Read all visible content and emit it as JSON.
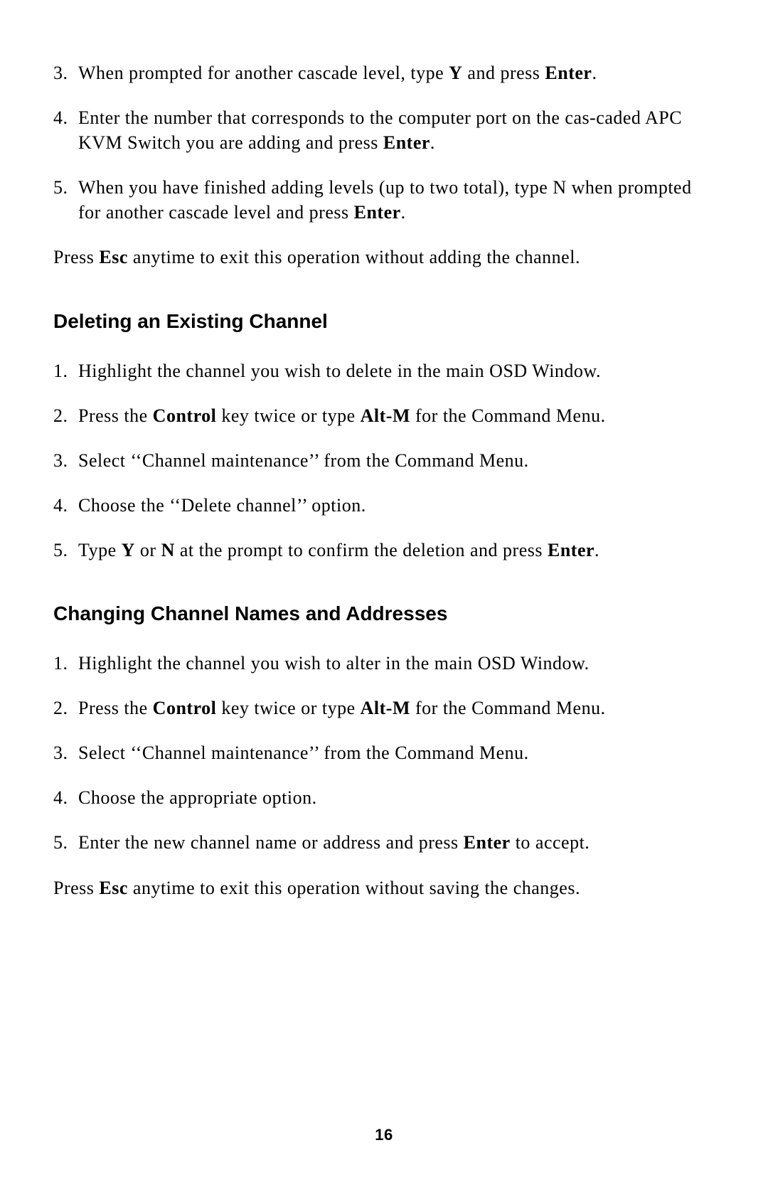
{
  "section1": {
    "items": [
      {
        "num": "3.",
        "pre": "When prompted for another cascade level, type ",
        "b1": "Y",
        "mid": " and press ",
        "b2": "Enter",
        "post": "."
      },
      {
        "num": "4.",
        "pre": "Enter the number that corresponds to the computer port on the cas-caded APC KVM Switch you are adding and press ",
        "b1": "Enter",
        "mid": "",
        "b2": "",
        "post": "."
      },
      {
        "num": "5.",
        "pre": "When you have finished adding levels (up to two total), type N when prompted for another cascade level and press ",
        "b1": "Enter",
        "mid": "",
        "b2": "",
        "post": "."
      }
    ],
    "footer": {
      "pre": "Press ",
      "b1": "Esc",
      "post": " anytime to exit this operation without adding the channel."
    }
  },
  "section2": {
    "heading": "Deleting an Existing Channel",
    "items": [
      {
        "num": "1.",
        "pre": "Highlight the channel you wish to delete in the main OSD Window.",
        "b1": "",
        "mid": "",
        "b2": "",
        "post": ""
      },
      {
        "num": "2.",
        "pre": "Press the ",
        "b1": "Control",
        "mid": " key twice or type ",
        "b2": "Alt-M",
        "post": " for the Command Menu."
      },
      {
        "num": "3.",
        "pre": "Select ‘‘Channel maintenance’’ from the Command Menu.",
        "b1": "",
        "mid": "",
        "b2": "",
        "post": ""
      },
      {
        "num": "4.",
        "pre": "Choose the ‘‘Delete channel’’ option.",
        "b1": "",
        "mid": "",
        "b2": "",
        "post": ""
      },
      {
        "num": "5.",
        "pre": "Type ",
        "b1": "Y",
        "mid": " or ",
        "b2": "N",
        "post_pre": " at the prompt to confirm the deletion and press ",
        "b3": "Enter",
        "post": "."
      }
    ]
  },
  "section3": {
    "heading": "Changing Channel Names and Addresses",
    "items": [
      {
        "num": "1.",
        "pre": "Highlight the channel you wish to alter in the main OSD Window.",
        "b1": "",
        "mid": "",
        "b2": "",
        "post": ""
      },
      {
        "num": "2.",
        "pre": "Press the ",
        "b1": "Control",
        "mid": " key twice or type ",
        "b2": "Alt-M",
        "post": " for the Command Menu."
      },
      {
        "num": "3.",
        "pre": "Select ‘‘Channel maintenance’’ from the Command Menu.",
        "b1": "",
        "mid": "",
        "b2": "",
        "post": ""
      },
      {
        "num": "4.",
        "pre": "Choose the appropriate option.",
        "b1": "",
        "mid": "",
        "b2": "",
        "post": ""
      },
      {
        "num": "5.",
        "pre": "Enter the new channel name or address and press ",
        "b1": "Enter",
        "mid": "",
        "b2": "",
        "post": " to accept."
      }
    ],
    "footer": {
      "pre": "Press ",
      "b1": "Esc",
      "post": " anytime to exit this operation without saving the changes."
    }
  },
  "page_number": "16"
}
